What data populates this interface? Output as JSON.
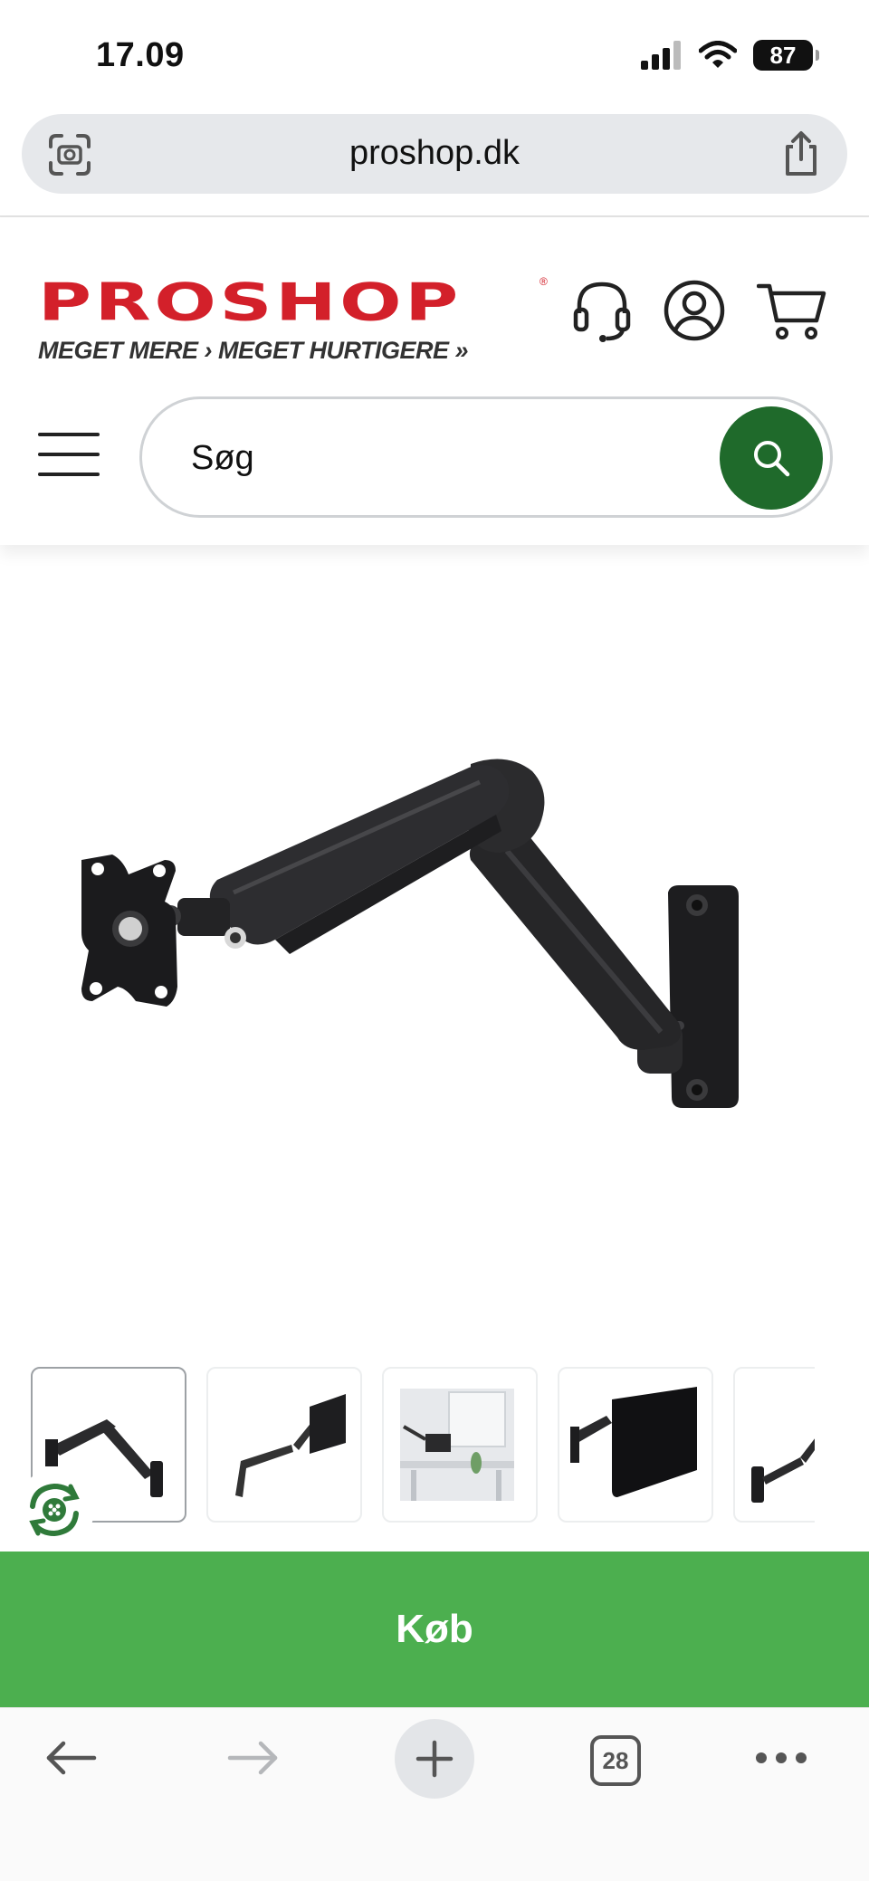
{
  "status_bar": {
    "time": "17.09",
    "battery": "87"
  },
  "browser": {
    "url": "proshop.dk",
    "tab_count": "28"
  },
  "header": {
    "logo_text": "PROSHOP",
    "logo_registered": "®",
    "logo_tagline": "MEGET MERE › MEGET HURTIGERE »",
    "search_placeholder": "Søg",
    "icons": [
      "headset-icon",
      "account-icon",
      "cart-icon",
      "menu-icon",
      "search-icon"
    ]
  },
  "product": {
    "buy_label": "Køb",
    "thumbnails": [
      "thumbnail-1",
      "thumbnail-2",
      "thumbnail-3",
      "thumbnail-4",
      "thumbnail-5"
    ],
    "active_thumbnail": 1
  },
  "colors": {
    "brand_red": "#d3202a",
    "search_green": "#1f6a2b",
    "buy_green": "#4caf4f"
  }
}
